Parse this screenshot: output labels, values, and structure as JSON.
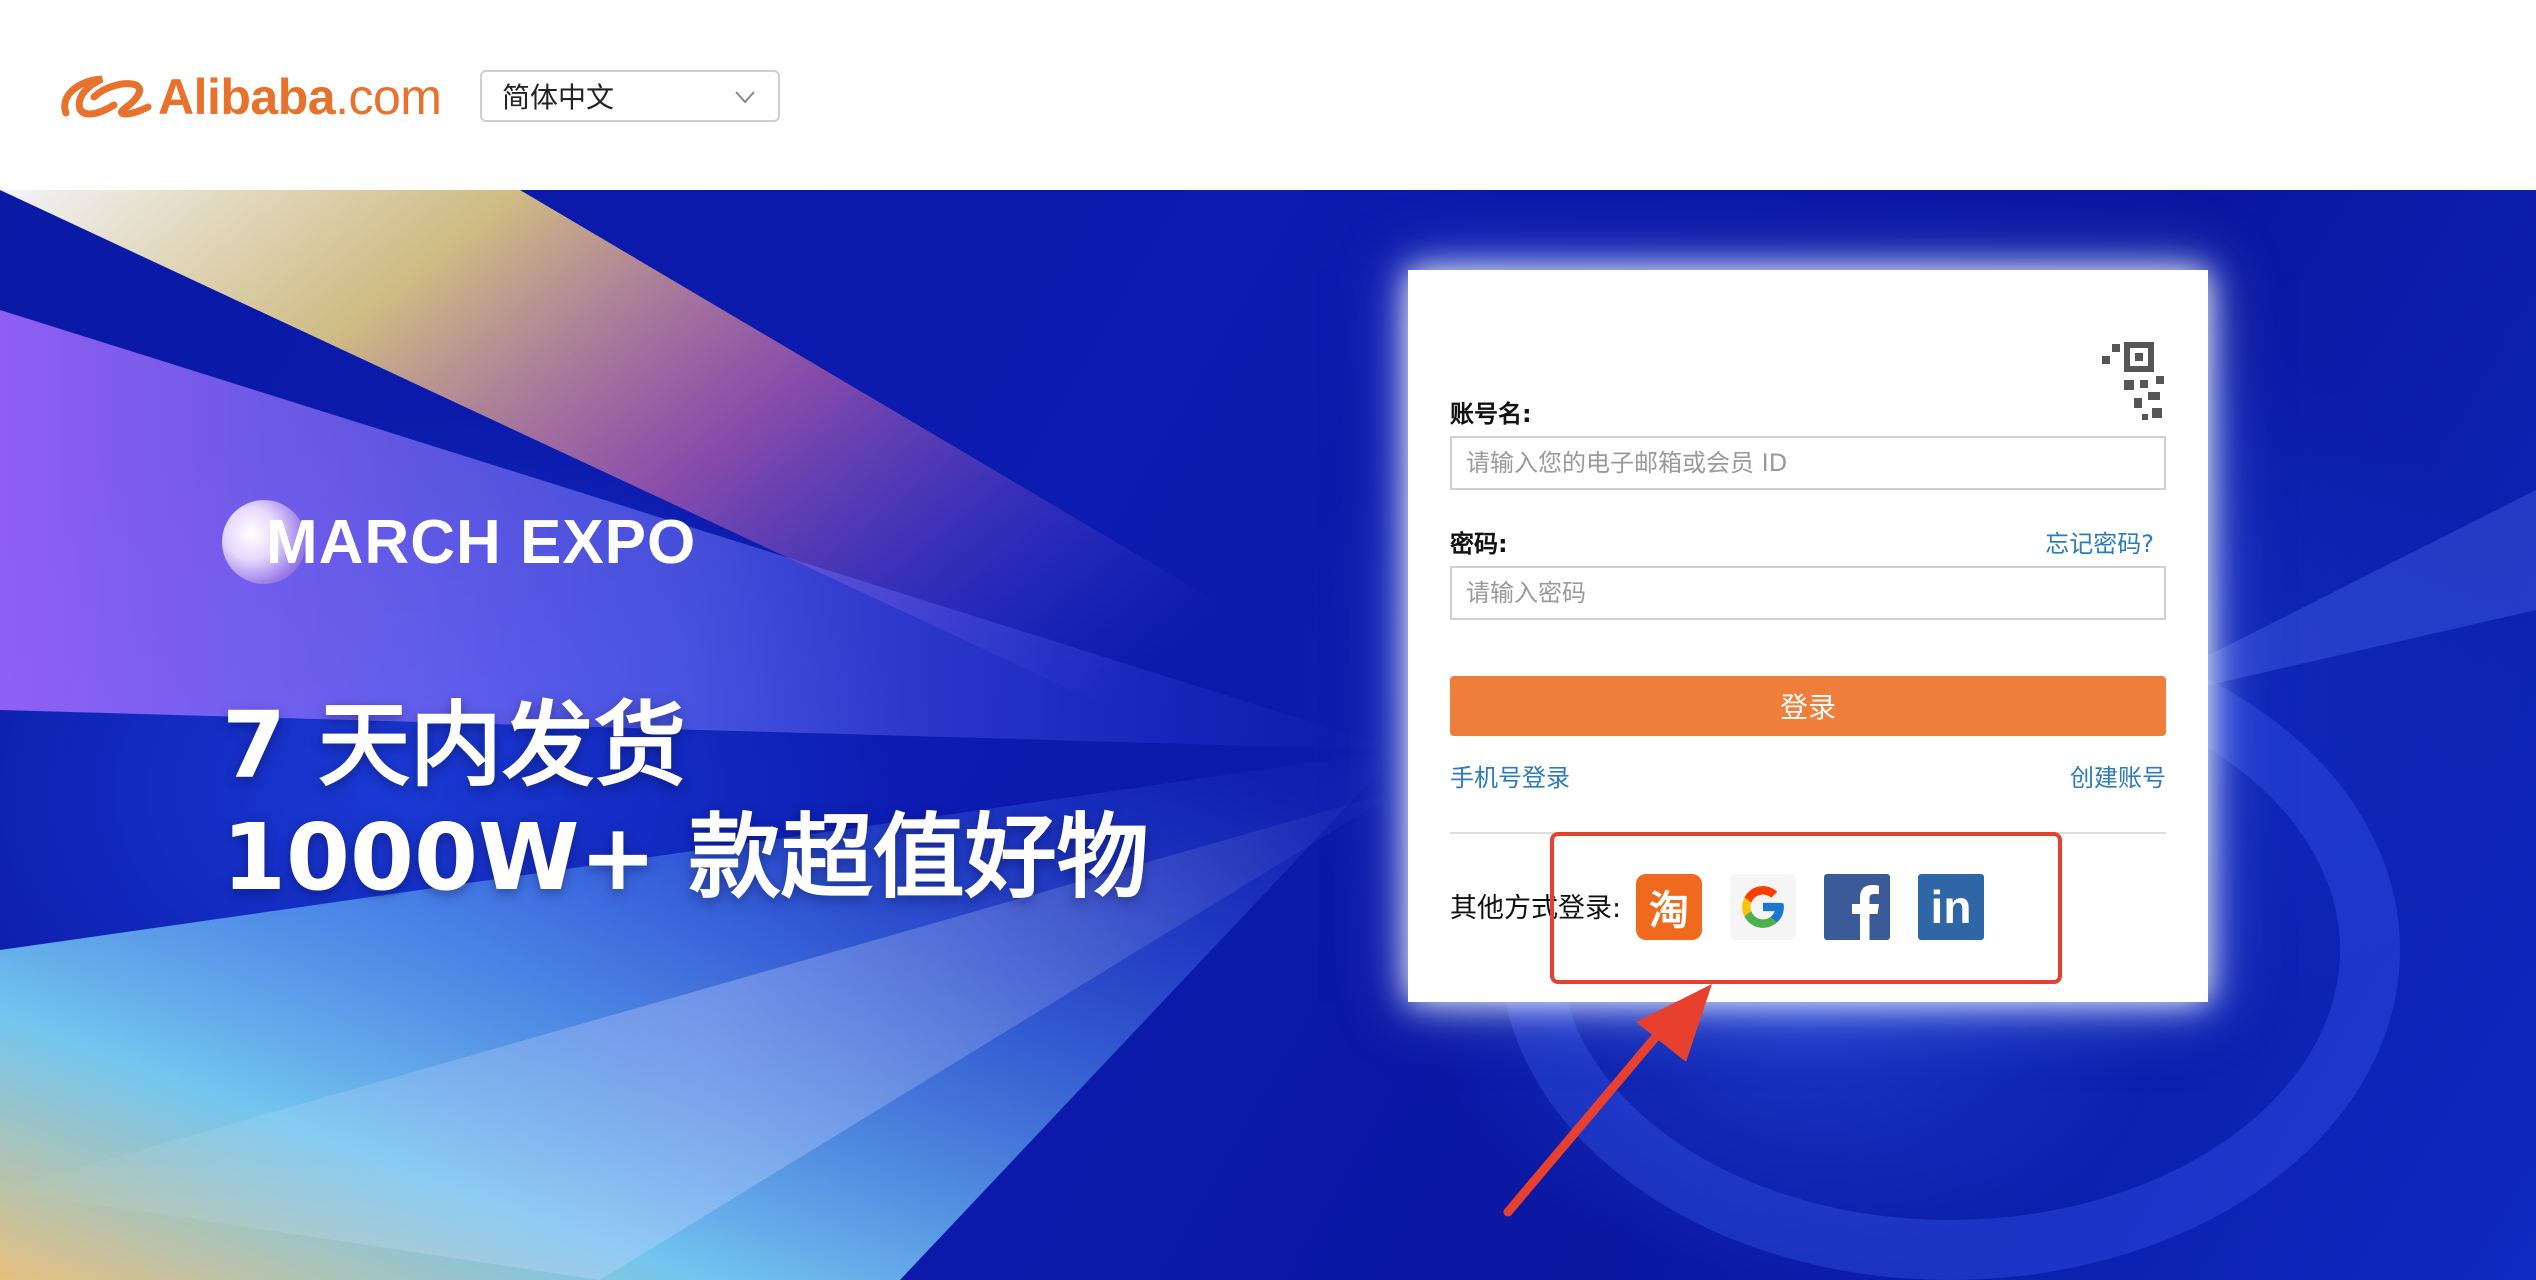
{
  "header": {
    "logo_text": "Alibaba",
    "logo_suffix": ".com",
    "language": {
      "selected": "简体中文"
    }
  },
  "banner": {
    "expo_title": "MARCH EXPO",
    "headline_line1": "7 天内发货",
    "headline_line2": "1000W+ 款超值好物"
  },
  "login": {
    "account_label": "账号名:",
    "account_placeholder": "请输入您的电子邮箱或会员 ID",
    "password_label": "密码:",
    "password_placeholder": "请输入密码",
    "forgot_password": "忘记密码?",
    "submit_label": "登录",
    "phone_login": "手机号登录",
    "create_account": "创建账号",
    "other_methods_label": "其他方式登录:",
    "social": [
      {
        "name": "taobao",
        "glyph": "淘",
        "icon": "taobao-icon",
        "color": "#f06a1d"
      },
      {
        "name": "google",
        "icon": "google-icon",
        "color": "#f5f5f5"
      },
      {
        "name": "facebook",
        "icon": "facebook-icon",
        "color": "#3b5b98"
      },
      {
        "name": "linkedin",
        "glyph": "in",
        "icon": "linkedin-icon",
        "color": "#2f67a6"
      }
    ]
  },
  "colors": {
    "brand_orange": "#e8712b",
    "button_orange": "#ee7e3a",
    "link_blue": "#2b7bbd",
    "banner_blue": "#0c1bb0",
    "annotation_red": "#e8402f"
  }
}
